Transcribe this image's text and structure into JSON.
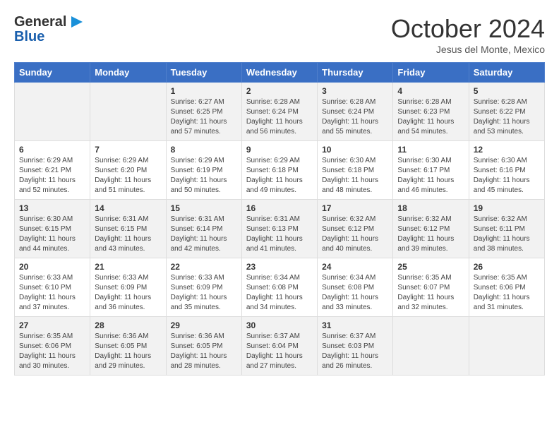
{
  "header": {
    "logo_line1": "General",
    "logo_line2": "Blue",
    "month": "October 2024",
    "location": "Jesus del Monte, Mexico"
  },
  "days_of_week": [
    "Sunday",
    "Monday",
    "Tuesday",
    "Wednesday",
    "Thursday",
    "Friday",
    "Saturday"
  ],
  "weeks": [
    [
      {
        "day": "",
        "info": ""
      },
      {
        "day": "",
        "info": ""
      },
      {
        "day": "1",
        "info": "Sunrise: 6:27 AM\nSunset: 6:25 PM\nDaylight: 11 hours and 57 minutes."
      },
      {
        "day": "2",
        "info": "Sunrise: 6:28 AM\nSunset: 6:24 PM\nDaylight: 11 hours and 56 minutes."
      },
      {
        "day": "3",
        "info": "Sunrise: 6:28 AM\nSunset: 6:24 PM\nDaylight: 11 hours and 55 minutes."
      },
      {
        "day": "4",
        "info": "Sunrise: 6:28 AM\nSunset: 6:23 PM\nDaylight: 11 hours and 54 minutes."
      },
      {
        "day": "5",
        "info": "Sunrise: 6:28 AM\nSunset: 6:22 PM\nDaylight: 11 hours and 53 minutes."
      }
    ],
    [
      {
        "day": "6",
        "info": "Sunrise: 6:29 AM\nSunset: 6:21 PM\nDaylight: 11 hours and 52 minutes."
      },
      {
        "day": "7",
        "info": "Sunrise: 6:29 AM\nSunset: 6:20 PM\nDaylight: 11 hours and 51 minutes."
      },
      {
        "day": "8",
        "info": "Sunrise: 6:29 AM\nSunset: 6:19 PM\nDaylight: 11 hours and 50 minutes."
      },
      {
        "day": "9",
        "info": "Sunrise: 6:29 AM\nSunset: 6:18 PM\nDaylight: 11 hours and 49 minutes."
      },
      {
        "day": "10",
        "info": "Sunrise: 6:30 AM\nSunset: 6:18 PM\nDaylight: 11 hours and 48 minutes."
      },
      {
        "day": "11",
        "info": "Sunrise: 6:30 AM\nSunset: 6:17 PM\nDaylight: 11 hours and 46 minutes."
      },
      {
        "day": "12",
        "info": "Sunrise: 6:30 AM\nSunset: 6:16 PM\nDaylight: 11 hours and 45 minutes."
      }
    ],
    [
      {
        "day": "13",
        "info": "Sunrise: 6:30 AM\nSunset: 6:15 PM\nDaylight: 11 hours and 44 minutes."
      },
      {
        "day": "14",
        "info": "Sunrise: 6:31 AM\nSunset: 6:15 PM\nDaylight: 11 hours and 43 minutes."
      },
      {
        "day": "15",
        "info": "Sunrise: 6:31 AM\nSunset: 6:14 PM\nDaylight: 11 hours and 42 minutes."
      },
      {
        "day": "16",
        "info": "Sunrise: 6:31 AM\nSunset: 6:13 PM\nDaylight: 11 hours and 41 minutes."
      },
      {
        "day": "17",
        "info": "Sunrise: 6:32 AM\nSunset: 6:12 PM\nDaylight: 11 hours and 40 minutes."
      },
      {
        "day": "18",
        "info": "Sunrise: 6:32 AM\nSunset: 6:12 PM\nDaylight: 11 hours and 39 minutes."
      },
      {
        "day": "19",
        "info": "Sunrise: 6:32 AM\nSunset: 6:11 PM\nDaylight: 11 hours and 38 minutes."
      }
    ],
    [
      {
        "day": "20",
        "info": "Sunrise: 6:33 AM\nSunset: 6:10 PM\nDaylight: 11 hours and 37 minutes."
      },
      {
        "day": "21",
        "info": "Sunrise: 6:33 AM\nSunset: 6:09 PM\nDaylight: 11 hours and 36 minutes."
      },
      {
        "day": "22",
        "info": "Sunrise: 6:33 AM\nSunset: 6:09 PM\nDaylight: 11 hours and 35 minutes."
      },
      {
        "day": "23",
        "info": "Sunrise: 6:34 AM\nSunset: 6:08 PM\nDaylight: 11 hours and 34 minutes."
      },
      {
        "day": "24",
        "info": "Sunrise: 6:34 AM\nSunset: 6:08 PM\nDaylight: 11 hours and 33 minutes."
      },
      {
        "day": "25",
        "info": "Sunrise: 6:35 AM\nSunset: 6:07 PM\nDaylight: 11 hours and 32 minutes."
      },
      {
        "day": "26",
        "info": "Sunrise: 6:35 AM\nSunset: 6:06 PM\nDaylight: 11 hours and 31 minutes."
      }
    ],
    [
      {
        "day": "27",
        "info": "Sunrise: 6:35 AM\nSunset: 6:06 PM\nDaylight: 11 hours and 30 minutes."
      },
      {
        "day": "28",
        "info": "Sunrise: 6:36 AM\nSunset: 6:05 PM\nDaylight: 11 hours and 29 minutes."
      },
      {
        "day": "29",
        "info": "Sunrise: 6:36 AM\nSunset: 6:05 PM\nDaylight: 11 hours and 28 minutes."
      },
      {
        "day": "30",
        "info": "Sunrise: 6:37 AM\nSunset: 6:04 PM\nDaylight: 11 hours and 27 minutes."
      },
      {
        "day": "31",
        "info": "Sunrise: 6:37 AM\nSunset: 6:03 PM\nDaylight: 11 hours and 26 minutes."
      },
      {
        "day": "",
        "info": ""
      },
      {
        "day": "",
        "info": ""
      }
    ]
  ]
}
